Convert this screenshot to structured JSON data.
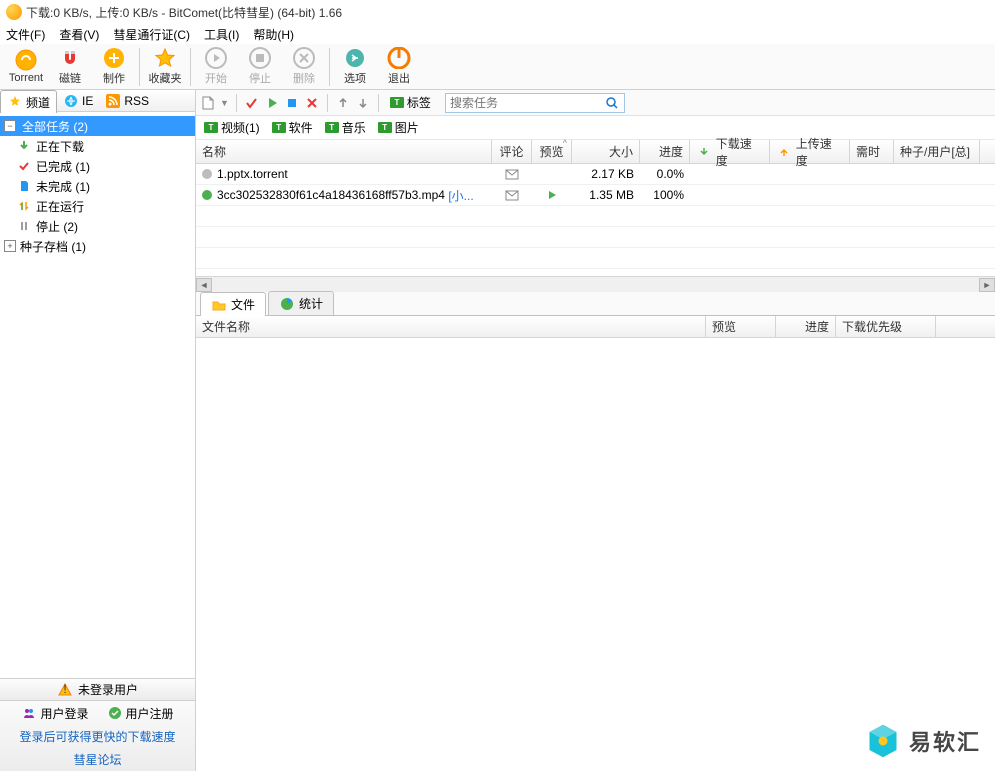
{
  "title": "下载:0 KB/s, 上传:0 KB/s - BitComet(比特彗星) (64-bit) 1.66",
  "menu": {
    "file": "文件(F)",
    "view": "查看(V)",
    "passport": "彗星通行证(C)",
    "tools": "工具(I)",
    "help": "帮助(H)"
  },
  "toolbar": {
    "torrent": "Torrent",
    "magnet": "磁链",
    "make": "制作",
    "favorites": "收藏夹",
    "start": "开始",
    "stop": "停止",
    "delete": "删除",
    "options": "选项",
    "exit": "退出"
  },
  "sub": {
    "label_tag": "标签",
    "search_placeholder": "搜索任务"
  },
  "side_tabs": {
    "channel": "频道",
    "ie": "IE",
    "rss": "RSS"
  },
  "tree": {
    "all": "全部任务 (2)",
    "downloading": "正在下载",
    "completed": "已完成 (1)",
    "incomplete": "未完成 (1)",
    "running": "正在运行",
    "stopped": "停止 (2)",
    "archive": "种子存档 (1)"
  },
  "user": {
    "header": "未登录用户",
    "login": "用户登录",
    "register": "用户注册",
    "tip": "登录后可获得更快的下载速度",
    "forum": "彗星论坛"
  },
  "filters": {
    "video": "视频(1)",
    "software": "软件",
    "music": "音乐",
    "picture": "图片"
  },
  "columns": {
    "name": "名称",
    "comment": "评论",
    "preview": "预览",
    "size": "大小",
    "progress": "进度",
    "dl": "下载速度",
    "ul": "上传速度",
    "time": "需时",
    "peers": "种子/用户[总]"
  },
  "tasks": [
    {
      "status": "gray",
      "name": "1.pptx.torrent",
      "size": "2.17 KB",
      "progress": "0.0%"
    },
    {
      "status": "green",
      "name": "3cc302532830f61c4a18436168ff57b3.mp4",
      "tag": "[小...",
      "preview": true,
      "size": "1.35 MB",
      "progress": "100%"
    }
  ],
  "detail_tabs": {
    "files": "文件",
    "stats": "统计"
  },
  "detail_cols": {
    "fname": "文件名称",
    "preview": "预览",
    "progress": "进度",
    "priority": "下载优先级"
  },
  "watermark": "易软汇"
}
